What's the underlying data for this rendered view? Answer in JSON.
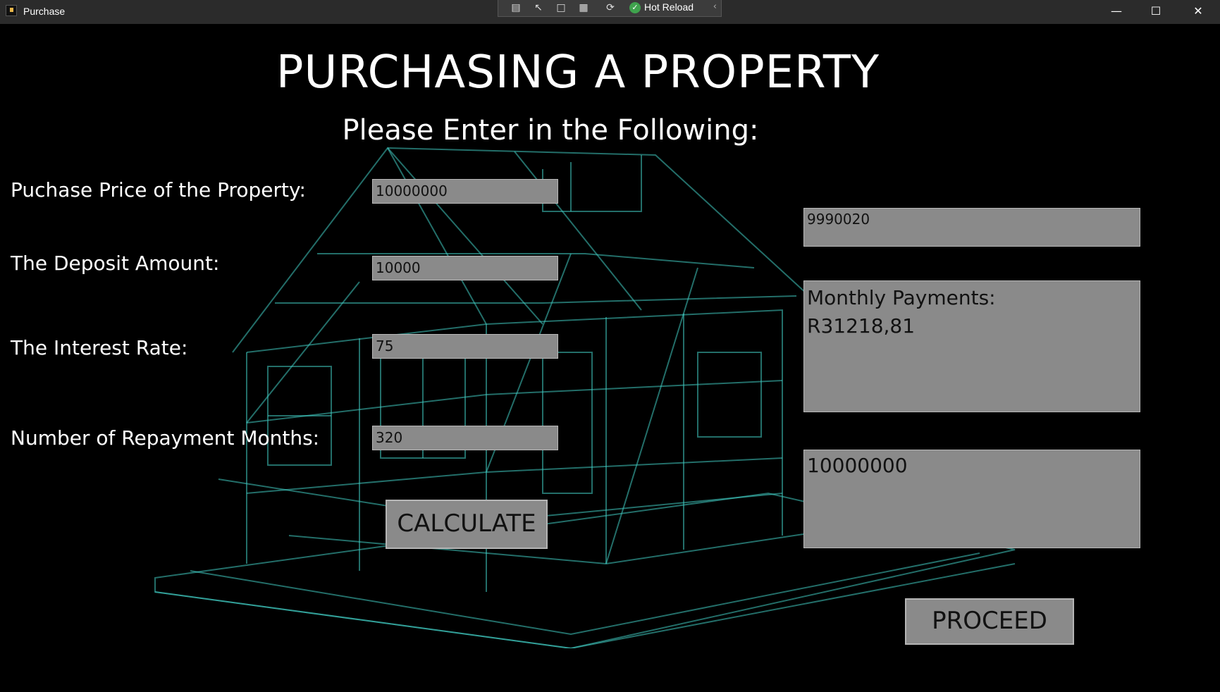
{
  "window": {
    "title": "Purchase"
  },
  "debug_toolbar": {
    "hot_reload_label": "Hot Reload"
  },
  "page": {
    "title": "PURCHASING A PROPERTY",
    "subtitle": "Please Enter in the Following:"
  },
  "form": {
    "purchase_price_label": "Puchase Price of the Property:",
    "purchase_price_value": "10000000",
    "deposit_label": "The Deposit Amount:",
    "deposit_value": "10000",
    "interest_label": "The Interest Rate:",
    "interest_value": "75",
    "months_label": "Number of Repayment Months:",
    "months_value": "320",
    "calculate_label": "CALCULATE"
  },
  "results": {
    "loan_amount": "9990020",
    "monthly_heading": "Monthly Payments:",
    "monthly_value": "R31218,81",
    "total_value": "10000000",
    "proceed_label": "PROCEED"
  },
  "colors": {
    "background": "#000000",
    "field_bg": "#8a8a8a",
    "wireframe": "#3fc9c0"
  }
}
